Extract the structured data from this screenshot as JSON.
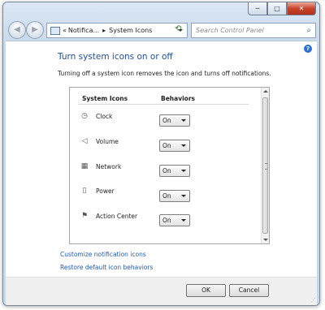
{
  "window": {
    "controls": {
      "minimize": "─",
      "maximize": "□",
      "close": "✕"
    }
  },
  "nav": {
    "back_glyph": "◀",
    "forward_glyph": "▶",
    "address": {
      "prefix": "«",
      "crumb1": "Notifica...",
      "separator": "▸",
      "crumb2": "System Icons"
    },
    "refresh_glyph": "⟲",
    "search": {
      "placeholder": "Search Control Panel",
      "icon_glyph": "⌕"
    }
  },
  "help": {
    "glyph": "?"
  },
  "page": {
    "title": "Turn system icons on or off",
    "description": "Turning off a system icon removes the icon and turns off notifications."
  },
  "table": {
    "headers": {
      "name": "System Icons",
      "behavior": "Behaviors"
    },
    "rows": [
      {
        "name": "Clock",
        "value": "On",
        "icon": "clock-icon",
        "glyph": "◷"
      },
      {
        "name": "Volume",
        "value": "On",
        "icon": "volume-icon",
        "glyph": "◁"
      },
      {
        "name": "Network",
        "value": "On",
        "icon": "network-icon",
        "glyph": "▦"
      },
      {
        "name": "Power",
        "value": "On",
        "icon": "power-icon",
        "glyph": "▯"
      },
      {
        "name": "Action Center",
        "value": "On",
        "icon": "flag-icon",
        "glyph": "⚑"
      }
    ]
  },
  "links": {
    "customize": "Customize notification icons",
    "restore": "Restore default icon behaviors"
  },
  "buttons": {
    "ok": "OK",
    "cancel": "Cancel"
  },
  "colors": {
    "title": "#1f4fa0",
    "link": "#1c5bb8",
    "close_button": "#c7432a"
  }
}
